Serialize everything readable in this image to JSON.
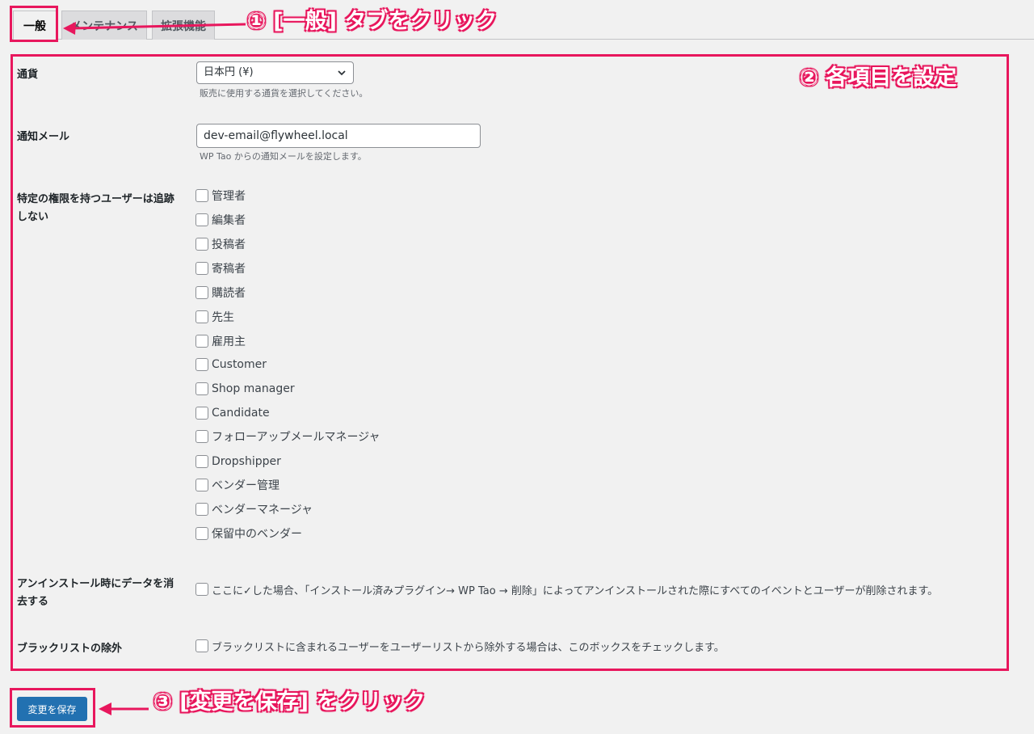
{
  "tabs": [
    {
      "label": "一般",
      "active": true
    },
    {
      "label": "メンテナンス",
      "active": false
    },
    {
      "label": "拡張機能",
      "active": false
    }
  ],
  "currency": {
    "label": "通貨",
    "value": "日本円 (¥)",
    "description": "販売に使用する通貨を選択してください。"
  },
  "notify_email": {
    "label": "通知メール",
    "value": "dev-email@flywheel.local",
    "description": "WP Tao からの通知メールを設定します。"
  },
  "exclude_roles": {
    "label": "特定の権限を持つユーザーは追跡しない",
    "roles": [
      "管理者",
      "編集者",
      "投稿者",
      "寄稿者",
      "購読者",
      "先生",
      "雇用主",
      "Customer",
      "Shop manager",
      "Candidate",
      "フォローアップメールマネージャ",
      "Dropshipper",
      "ベンダー管理",
      "ベンダーマネージャ",
      "保留中のベンダー"
    ]
  },
  "uninstall": {
    "label": "アンインストール時にデータを消去する",
    "checkbox_label": "ここに✓した場合、「インストール済みプラグイン→ WP Tao → 削除」によってアンインストールされた際にすべてのイベントとユーザーが削除されます。"
  },
  "blacklist": {
    "label": "ブラックリストの除外",
    "checkbox_label": "ブラックリストに含まれるユーザーをユーザーリストから除外する場合は、このボックスをチェックします。"
  },
  "save_button": "変更を保存",
  "annotations": {
    "step1": "① [一般] タブをクリック",
    "step2": "② 各項目を設定",
    "step3": "③ [変更を保存] をクリック",
    "color": "#e8175d"
  },
  "colors": {
    "primary_button": "#2271b1",
    "background": "#f1f1f1"
  }
}
